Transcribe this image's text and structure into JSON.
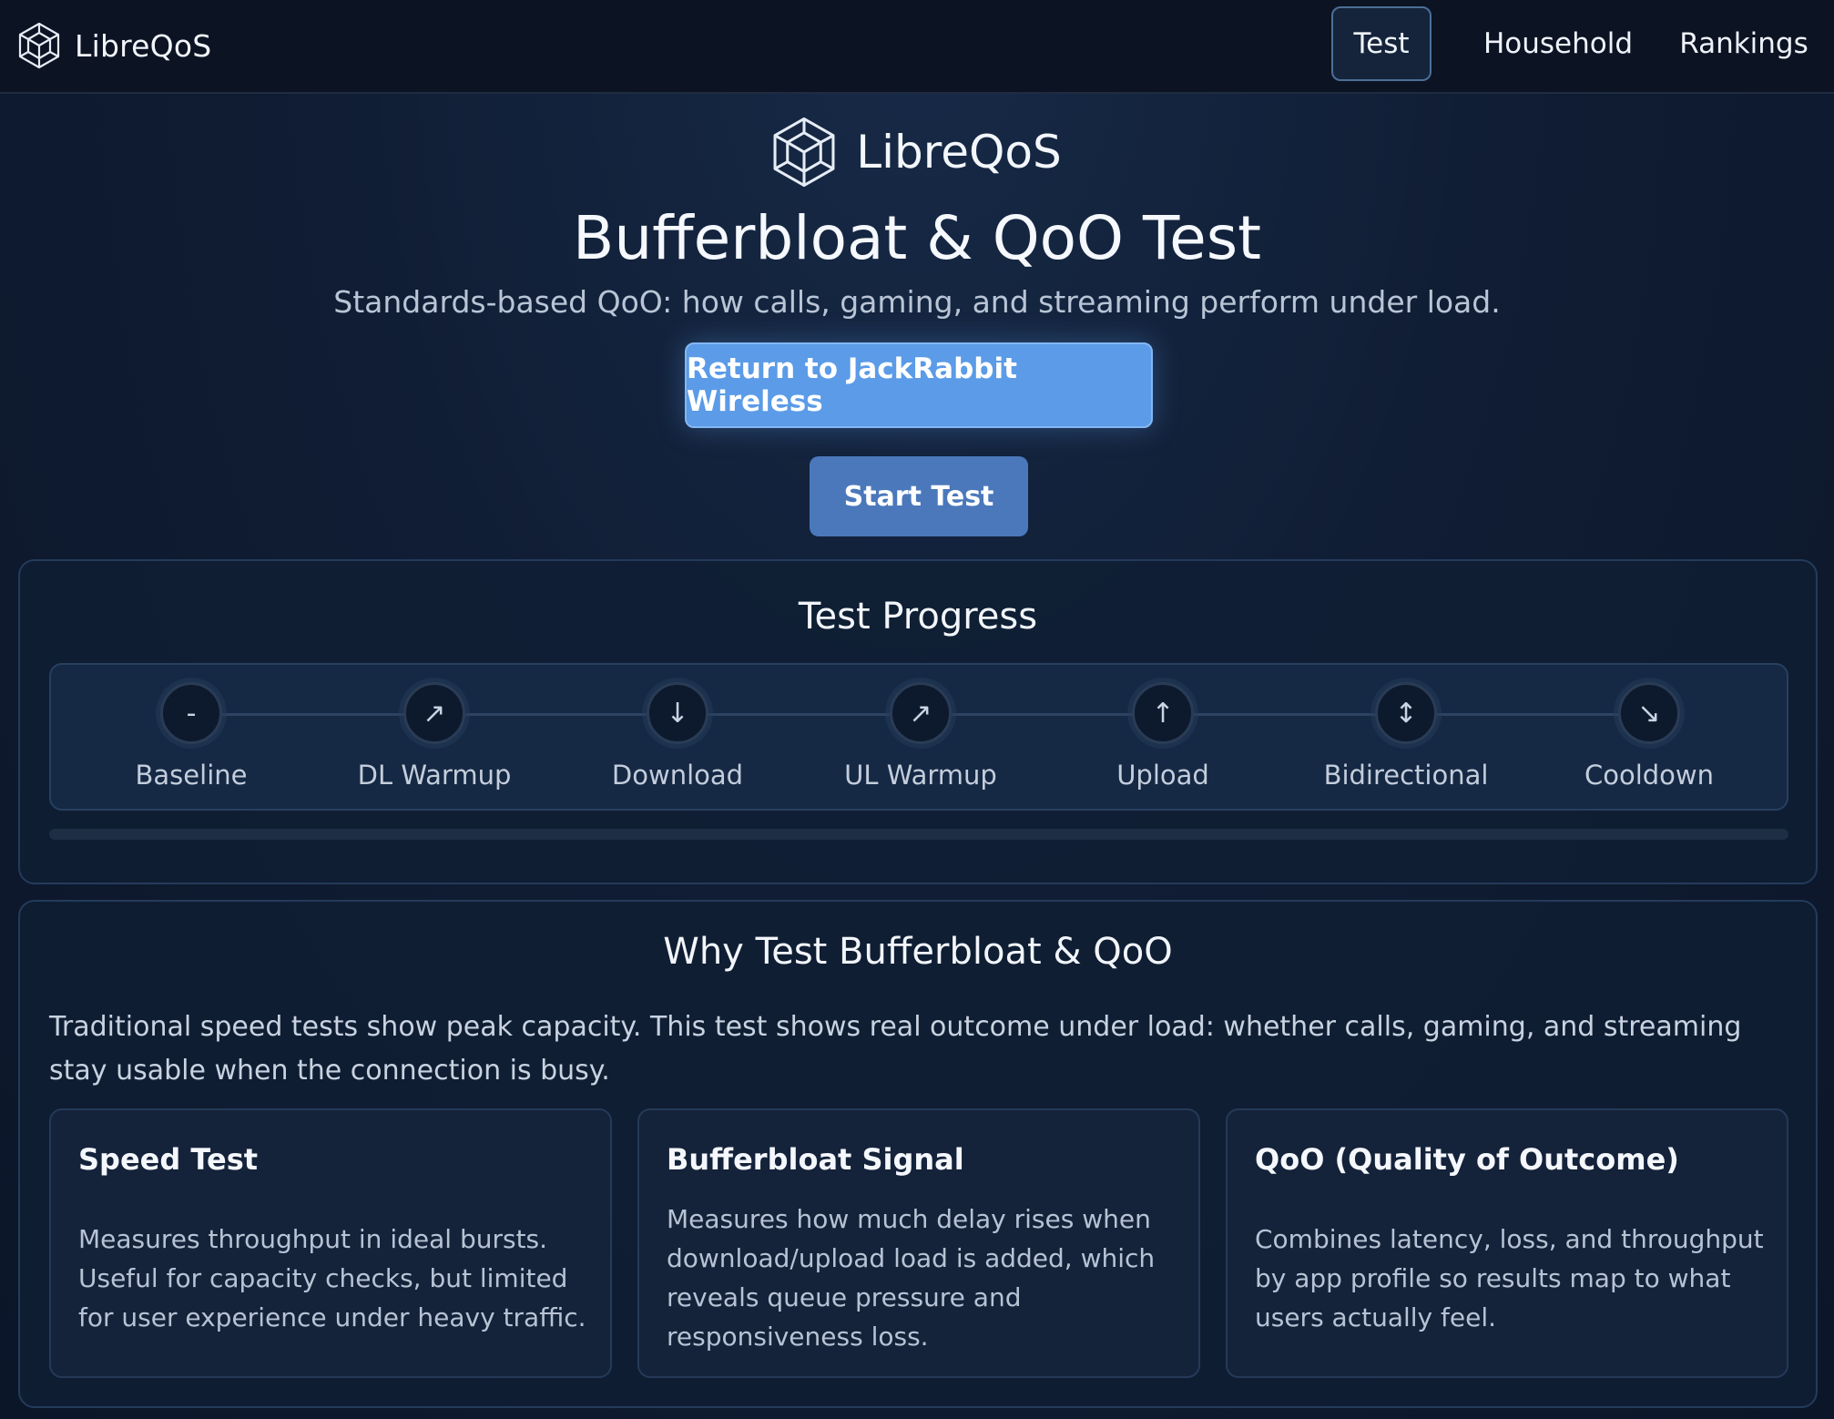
{
  "topbar": {
    "brand": "LibreQoS",
    "tabs": [
      {
        "label": "Test",
        "active": true
      },
      {
        "label": "Household",
        "active": false
      },
      {
        "label": "Rankings",
        "active": false
      }
    ]
  },
  "hero": {
    "brand": "LibreQoS",
    "title": "Bufferbloat & QoO Test",
    "subtitle": "Standards-based QoO: how calls, gaming, and streaming perform under load.",
    "return_button": "Return to JackRabbit Wireless",
    "start_button": "Start Test"
  },
  "progress": {
    "title": "Test Progress",
    "stages": [
      {
        "label": "Baseline",
        "glyph": "-",
        "icon": "dash-icon"
      },
      {
        "label": "DL Warmup",
        "glyph": "↗",
        "icon": "arrow-up-right-icon"
      },
      {
        "label": "Download",
        "glyph": "↓",
        "icon": "arrow-down-icon"
      },
      {
        "label": "UL Warmup",
        "glyph": "↗",
        "icon": "arrow-up-right-icon"
      },
      {
        "label": "Upload",
        "glyph": "↑",
        "icon": "arrow-up-icon"
      },
      {
        "label": "Bidirectional",
        "glyph": "↕",
        "icon": "arrow-up-down-icon"
      },
      {
        "label": "Cooldown",
        "glyph": "↘",
        "icon": "arrow-down-right-icon"
      }
    ],
    "percent_complete": 0
  },
  "why": {
    "title": "Why Test Bufferbloat & QoO",
    "intro": "Traditional speed tests show peak capacity. This test shows real outcome under load: whether calls, gaming, and streaming stay usable when the connection is busy.",
    "cards": [
      {
        "title": "Speed Test",
        "body": "Measures throughput in ideal bursts. Useful for capacity checks, but limited for user experience under heavy traffic."
      },
      {
        "title": "Bufferbloat Signal",
        "body": "Measures how much delay rises when download/upload load is added, which reveals queue pressure and responsiveness loss."
      },
      {
        "title": "QoO (Quality of Outcome)",
        "body": "Combines latency, loss, and throughput by app profile so results map to what users actually feel."
      }
    ]
  },
  "colors": {
    "accent": "#5b9be7",
    "start_button": "#4a78bb",
    "background": "#101d34",
    "topbar": "#0c1322"
  }
}
